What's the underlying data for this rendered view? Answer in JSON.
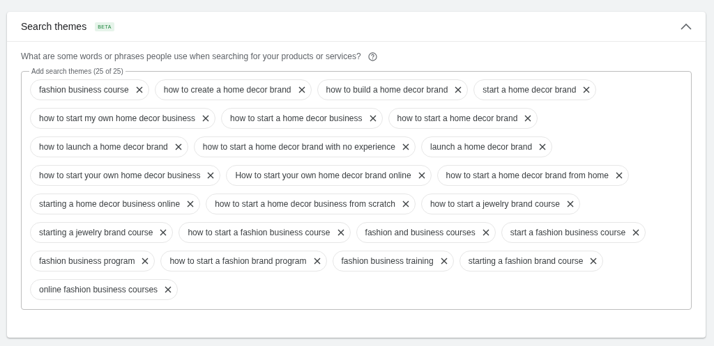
{
  "card": {
    "title": "Search themes",
    "badge": "BETA",
    "expanded": true
  },
  "question": "What are some words or phrases people use when searching for your products or services?",
  "field": {
    "label": "Add search themes (25 of 25)",
    "rows": [
      {
        "chips": [
          "fashion business course",
          "how to create a home decor brand",
          "how to build a home decor brand",
          "start a home decor brand"
        ]
      },
      {
        "chips": [
          "how to start my own home decor business",
          "how to start a home decor business",
          "how to start a home decor brand"
        ]
      },
      {
        "chips": [
          "how to launch a home decor brand",
          "how to start a home decor brand with no experience",
          "launch a home decor brand"
        ]
      },
      {
        "chips": [
          "how to start your own home decor business",
          "How to start your own home decor brand online",
          "how to start a home decor brand from home"
        ]
      },
      {
        "chips": [
          "starting a home decor business online",
          "how to start a home decor business from scratch",
          "how to start a jewelry brand course"
        ]
      },
      {
        "chips": [
          "starting a jewelry brand course",
          "how to start a fashion business course",
          "fashion and business courses",
          "start a fashion business course"
        ]
      },
      {
        "chips": [
          "fashion business program",
          "how to start a fashion brand program",
          "fashion business training",
          "starting a fashion brand course"
        ]
      },
      {
        "chips": [
          "online fashion business courses"
        ]
      }
    ]
  }
}
